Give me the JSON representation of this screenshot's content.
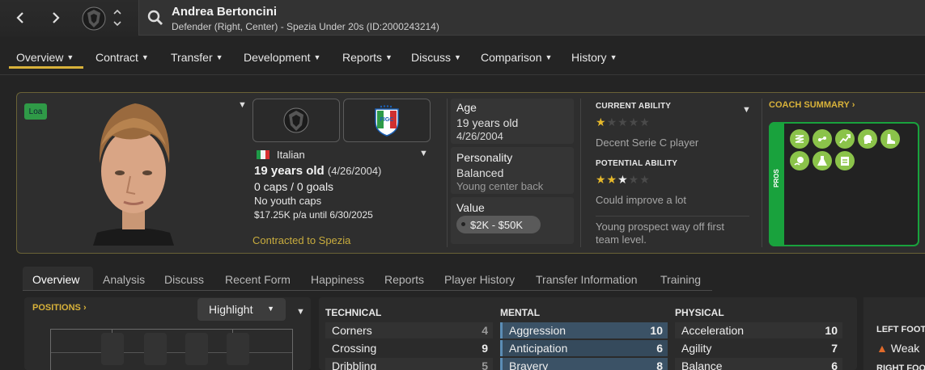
{
  "header": {
    "player_name": "Andrea Bertoncini",
    "player_subtitle": "Defender (Right, Center) - Spezia Under 20s (ID:2000243214)"
  },
  "menu": {
    "items": [
      {
        "label": "Overview"
      },
      {
        "label": "Contract"
      },
      {
        "label": "Transfer"
      },
      {
        "label": "Development"
      },
      {
        "label": "Reports"
      },
      {
        "label": "Discuss"
      },
      {
        "label": "Comparison"
      },
      {
        "label": "History"
      }
    ]
  },
  "profile": {
    "loan_badge": "Loa",
    "nationality": "Italian",
    "age_line": "19 years old",
    "dob_paren": "(4/26/2004)",
    "caps": "0 caps / 0 goals",
    "youth_caps": "No youth caps",
    "wage": "$17.25K p/a until 6/30/2025",
    "contract_status": "Contracted to Spezia",
    "federation_badge": "FIGC"
  },
  "info": {
    "age_label": "Age",
    "age_value": "19 years old",
    "age_dob": "4/26/2004",
    "personality_label": "Personality",
    "personality_value": "Balanced",
    "personality_desc": "Young center back",
    "value_label": "Value",
    "value_amount": "$2K - $50K"
  },
  "ability": {
    "current_label": "CURRENT ABILITY",
    "current_desc": "Decent Serie C player",
    "current_stars": 1,
    "potential_label": "POTENTIAL ABILITY",
    "potential_desc": "Could improve a lot",
    "potential_stars": 2.5,
    "summary": "Young prospect way off first team level."
  },
  "coach": {
    "title": "COACH SUMMARY",
    "pros_label": "PROS",
    "pros_icons": [
      "spring-icon",
      "pass-icon",
      "trend-up-icon",
      "head-icon",
      "boot-icon",
      "ball-icon",
      "flask-icon",
      "clipboard-icon"
    ]
  },
  "tabs": [
    {
      "label": "Overview"
    },
    {
      "label": "Analysis"
    },
    {
      "label": "Discuss"
    },
    {
      "label": "Recent Form"
    },
    {
      "label": "Happiness"
    },
    {
      "label": "Reports"
    },
    {
      "label": "Player History"
    },
    {
      "label": "Transfer Information"
    },
    {
      "label": "Training"
    }
  ],
  "positions": {
    "title": "POSITIONS",
    "highlight_label": "Highlight"
  },
  "attributes": {
    "technical": {
      "title": "TECHNICAL",
      "rows": [
        {
          "name": "Corners",
          "value": "4"
        },
        {
          "name": "Crossing",
          "value": "9"
        },
        {
          "name": "Dribbling",
          "value": "5"
        }
      ]
    },
    "mental": {
      "title": "MENTAL",
      "rows": [
        {
          "name": "Aggression",
          "value": "10"
        },
        {
          "name": "Anticipation",
          "value": "6"
        },
        {
          "name": "Bravery",
          "value": "8"
        }
      ]
    },
    "physical": {
      "title": "PHYSICAL",
      "rows": [
        {
          "name": "Acceleration",
          "value": "10"
        },
        {
          "name": "Agility",
          "value": "7"
        },
        {
          "name": "Balance",
          "value": "6"
        }
      ]
    }
  },
  "foot": {
    "left_label": "LEFT FOOT",
    "left_value": "Weak",
    "right_label": "RIGHT FOOT"
  },
  "colors": {
    "accent": "#d8b23a",
    "pros_green": "#19a23d",
    "background": "#242424"
  }
}
